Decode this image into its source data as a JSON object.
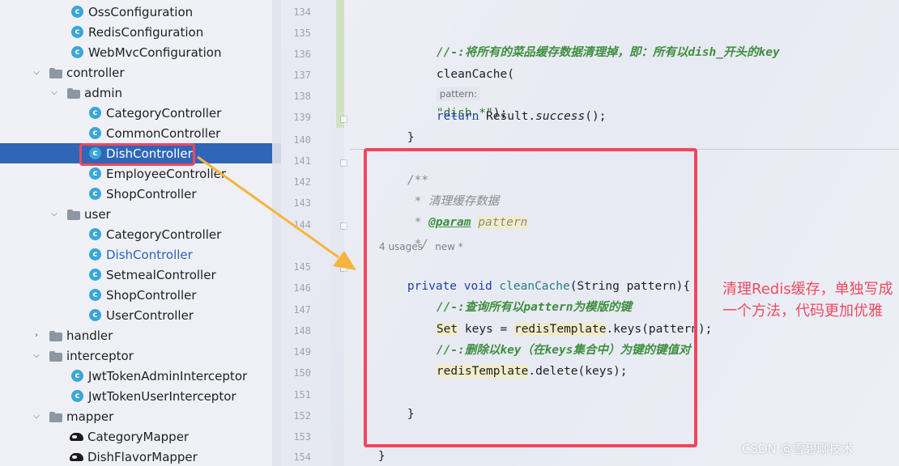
{
  "project_tree": {
    "rows": [
      {
        "label": "OssConfiguration",
        "type": "class"
      },
      {
        "label": "RedisConfiguration",
        "type": "class"
      },
      {
        "label": "WebMvcConfiguration",
        "type": "class"
      },
      {
        "label": "controller",
        "type": "package",
        "expanded": true
      },
      {
        "label": "admin",
        "type": "package",
        "expanded": true
      },
      {
        "label": "CategoryController",
        "type": "class"
      },
      {
        "label": "CommonController",
        "type": "class"
      },
      {
        "label": "DishController",
        "type": "class",
        "selected": true
      },
      {
        "label": "EmployeeController",
        "type": "class"
      },
      {
        "label": "ShopController",
        "type": "class"
      },
      {
        "label": "user",
        "type": "package",
        "expanded": true
      },
      {
        "label": "CategoryController",
        "type": "class"
      },
      {
        "label": "DishController",
        "type": "class",
        "modified": true
      },
      {
        "label": "SetmealController",
        "type": "class"
      },
      {
        "label": "ShopController",
        "type": "class"
      },
      {
        "label": "UserController",
        "type": "class"
      },
      {
        "label": "handler",
        "type": "package",
        "expanded": false
      },
      {
        "label": "interceptor",
        "type": "package",
        "expanded": true
      },
      {
        "label": "JwtTokenAdminInterceptor",
        "type": "class"
      },
      {
        "label": "JwtTokenUserInterceptor",
        "type": "class"
      },
      {
        "label": "mapper",
        "type": "package",
        "expanded": true
      },
      {
        "label": "CategoryMapper",
        "type": "mapper"
      },
      {
        "label": "DishFlavorMapper",
        "type": "mapper"
      }
    ]
  },
  "gutter": {
    "line_numbers": [
      "134",
      "135",
      "136",
      "137",
      "138",
      "139",
      "140",
      "141",
      "142",
      "143",
      "144",
      "145",
      "146",
      "147",
      "148",
      "149",
      "150",
      "151",
      "152",
      "153",
      "154"
    ]
  },
  "code": {
    "l135_comment": "//-:将所有的菜品缓存数据清理掉，即：所有以dish_开头的key",
    "l136_call": "cleanCache(",
    "l136_hint": "pattern:",
    "l136_arg": "\"dish_*\"",
    "l136_end": ");",
    "l138_return": "return",
    "l138_result": " Result.",
    "l138_success": "success",
    "l138_end": "();",
    "l139_brace": "}",
    "l141_doc_open": "/**",
    "l142_doc_line": " * 清理缓存数据",
    "l143_doc_star": " * ",
    "l143_doc_tag": "@param",
    "l143_doc_name": "pattern",
    "l144_doc_close": " */",
    "usage_count": "4 usages",
    "usage_new": "new *",
    "l145_private": "private",
    "l145_void": "void",
    "l145_name": "cleanCache",
    "l145_params": "(String pattern){",
    "l146_comment": "//-:查询所有以pattern为模版的键",
    "l147_type": "Set",
    "l147_var": " keys = ",
    "l147_obj": "redisTemplate",
    "l147_call": ".keys(pattern);",
    "l148_comment": "//-:删除以key（在keys集合中）为键的键值对",
    "l149_obj": "redisTemplate",
    "l149_call": ".delete(keys);",
    "l151_brace": "}",
    "l153_brace": "}"
  },
  "annotation": {
    "note_text": "清理Redis缓存，单独写成一个方法，代码更加优雅",
    "box_color": "#f1465c",
    "arrow_color": "#f7b43c"
  },
  "watermark": "CSDN @雪碧聊技术"
}
